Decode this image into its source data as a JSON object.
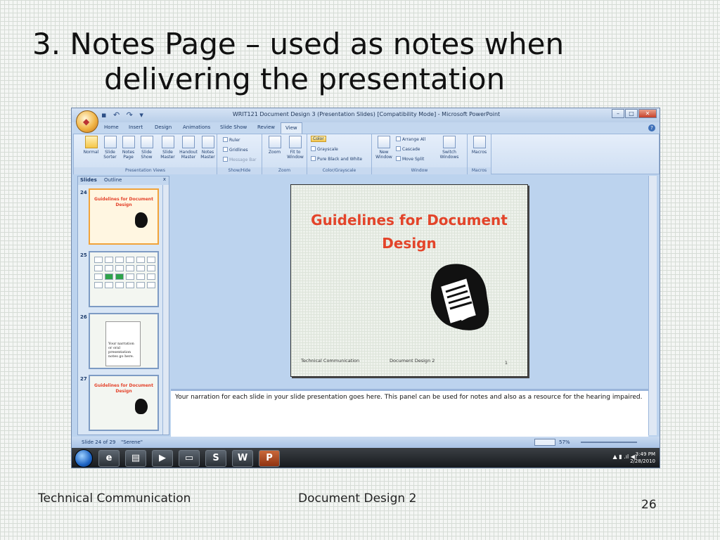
{
  "title": {
    "line1": "3. Notes Page – used as notes when",
    "line2": "delivering the presentation"
  },
  "window": {
    "title": "WRIT121 Document Design 3 (Presentation Slides) [Compatibility Mode] - Microsoft PowerPoint",
    "controls": [
      "–",
      "□",
      "✕"
    ]
  },
  "ribbon": {
    "tabs": [
      "Home",
      "Insert",
      "Design",
      "Animations",
      "Slide Show",
      "Review",
      "View"
    ],
    "active_tab": "View",
    "groups": {
      "presentation_views": {
        "label": "Presentation Views",
        "buttons": [
          "Normal",
          "Slide Sorter",
          "Notes Page",
          "Slide Show",
          "Slide Master",
          "Handout Master",
          "Notes Master"
        ]
      },
      "show_hide": {
        "label": "Show/Hide",
        "items": [
          "Ruler",
          "Gridlines",
          "Message Bar"
        ]
      },
      "zoom": {
        "label": "Zoom",
        "buttons": [
          "Zoom",
          "Fit to Window"
        ]
      },
      "color": {
        "label": "Color/Grayscale",
        "items": [
          "Color",
          "Grayscale",
          "Pure Black and White"
        ]
      },
      "window": {
        "label": "Window",
        "buttons": [
          "New Window",
          "Switch Windows"
        ],
        "items": [
          "Arrange All",
          "Cascade",
          "Move Split"
        ]
      },
      "macros": {
        "label": "Macros",
        "buttons": [
          "Macros"
        ]
      }
    }
  },
  "slides_panel": {
    "tabs": [
      "Slides",
      "Outline"
    ],
    "close": "x",
    "thumbnails": [
      {
        "number": "24",
        "title": "Guidelines for Document Design",
        "active": true
      },
      {
        "number": "25"
      },
      {
        "number": "26",
        "text": "Your narration or oral presentation notes go here."
      },
      {
        "number": "27",
        "title": "Guidelines for Document Design"
      }
    ]
  },
  "slide": {
    "title": "Guidelines for Document Design",
    "footer_left": "Technical Communication",
    "footer_center": "Document Design 2",
    "number": "1"
  },
  "notes_text": "Your narration for each slide in your slide presentation goes here. This panel can be used  for notes and also as a resource for the hearing impaired.",
  "status": {
    "slide": "Slide 24 of 29",
    "theme": "\"Serene\"",
    "zoom": "57%"
  },
  "taskbar": {
    "time": "3:49 PM",
    "date": "2/28/2010"
  },
  "footer": {
    "left": "Technical Communication",
    "center": "Document Design 2",
    "page": "26"
  },
  "colors": {
    "slide_title": "#e3442a",
    "ribbon": "#cfdff3",
    "taskbar": "#14171b"
  }
}
